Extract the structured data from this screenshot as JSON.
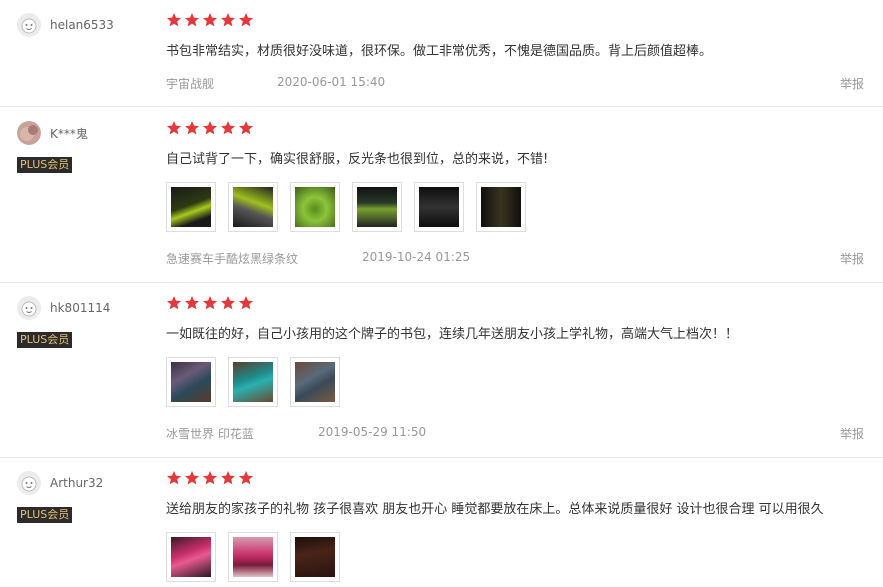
{
  "colors": {
    "star": "#e4393c",
    "plus_bg": "#2b2b2b",
    "plus_text": "#e6c176"
  },
  "reviews": [
    {
      "username": "helan6533",
      "plus": false,
      "stars": 5,
      "content": "书包非常结实，材质很好没味道，很环保。做工非常优秀，不愧是德国品质。背上后颜值超棒。",
      "photos": [],
      "spec": "宇宙战舰",
      "time": "2020-06-01 15:40",
      "report": "举报"
    },
    {
      "username": "K***鬼",
      "plus": true,
      "plus_label": "PLUS会员",
      "stars": 5,
      "content": "自己试背了一下，确实很舒服，反光条也很到位，总的来说，不错!",
      "photos": [
        "backpack-black-green-1",
        "backpack-black-green-2",
        "backpack-green-3",
        "backpack-black-green-4",
        "backpack-dark-5",
        "backpack-dark-6"
      ],
      "spec": "急速赛车手酷炫黑绿条纹",
      "time": "2019-10-24 01:25",
      "report": "举报"
    },
    {
      "username": "hk801114",
      "plus": true,
      "plus_label": "PLUS会员",
      "stars": 5,
      "content": "一如既往的好，自己小孩用的这个牌子的书包，连续几年送朋友小孩上学礼物，高端大气上档次！！",
      "photos": [
        "backpack-print-1",
        "backpack-teal-2",
        "backpack-print-3"
      ],
      "spec": "冰雪世界 印花蓝",
      "time": "2019-05-29 11:50",
      "report": "举报"
    },
    {
      "username": "Arthur32",
      "plus": true,
      "plus_label": "PLUS会员",
      "stars": 5,
      "content": "送给朋友的家孩子的礼物 孩子很喜欢 朋友也开心 睡觉都要放在床上。总体来说质量很好 设计也很合理 可以用很久",
      "photos": [
        "backpack-pink-1",
        "backpack-pink-2",
        "backpack-dark-3"
      ]
    }
  ]
}
